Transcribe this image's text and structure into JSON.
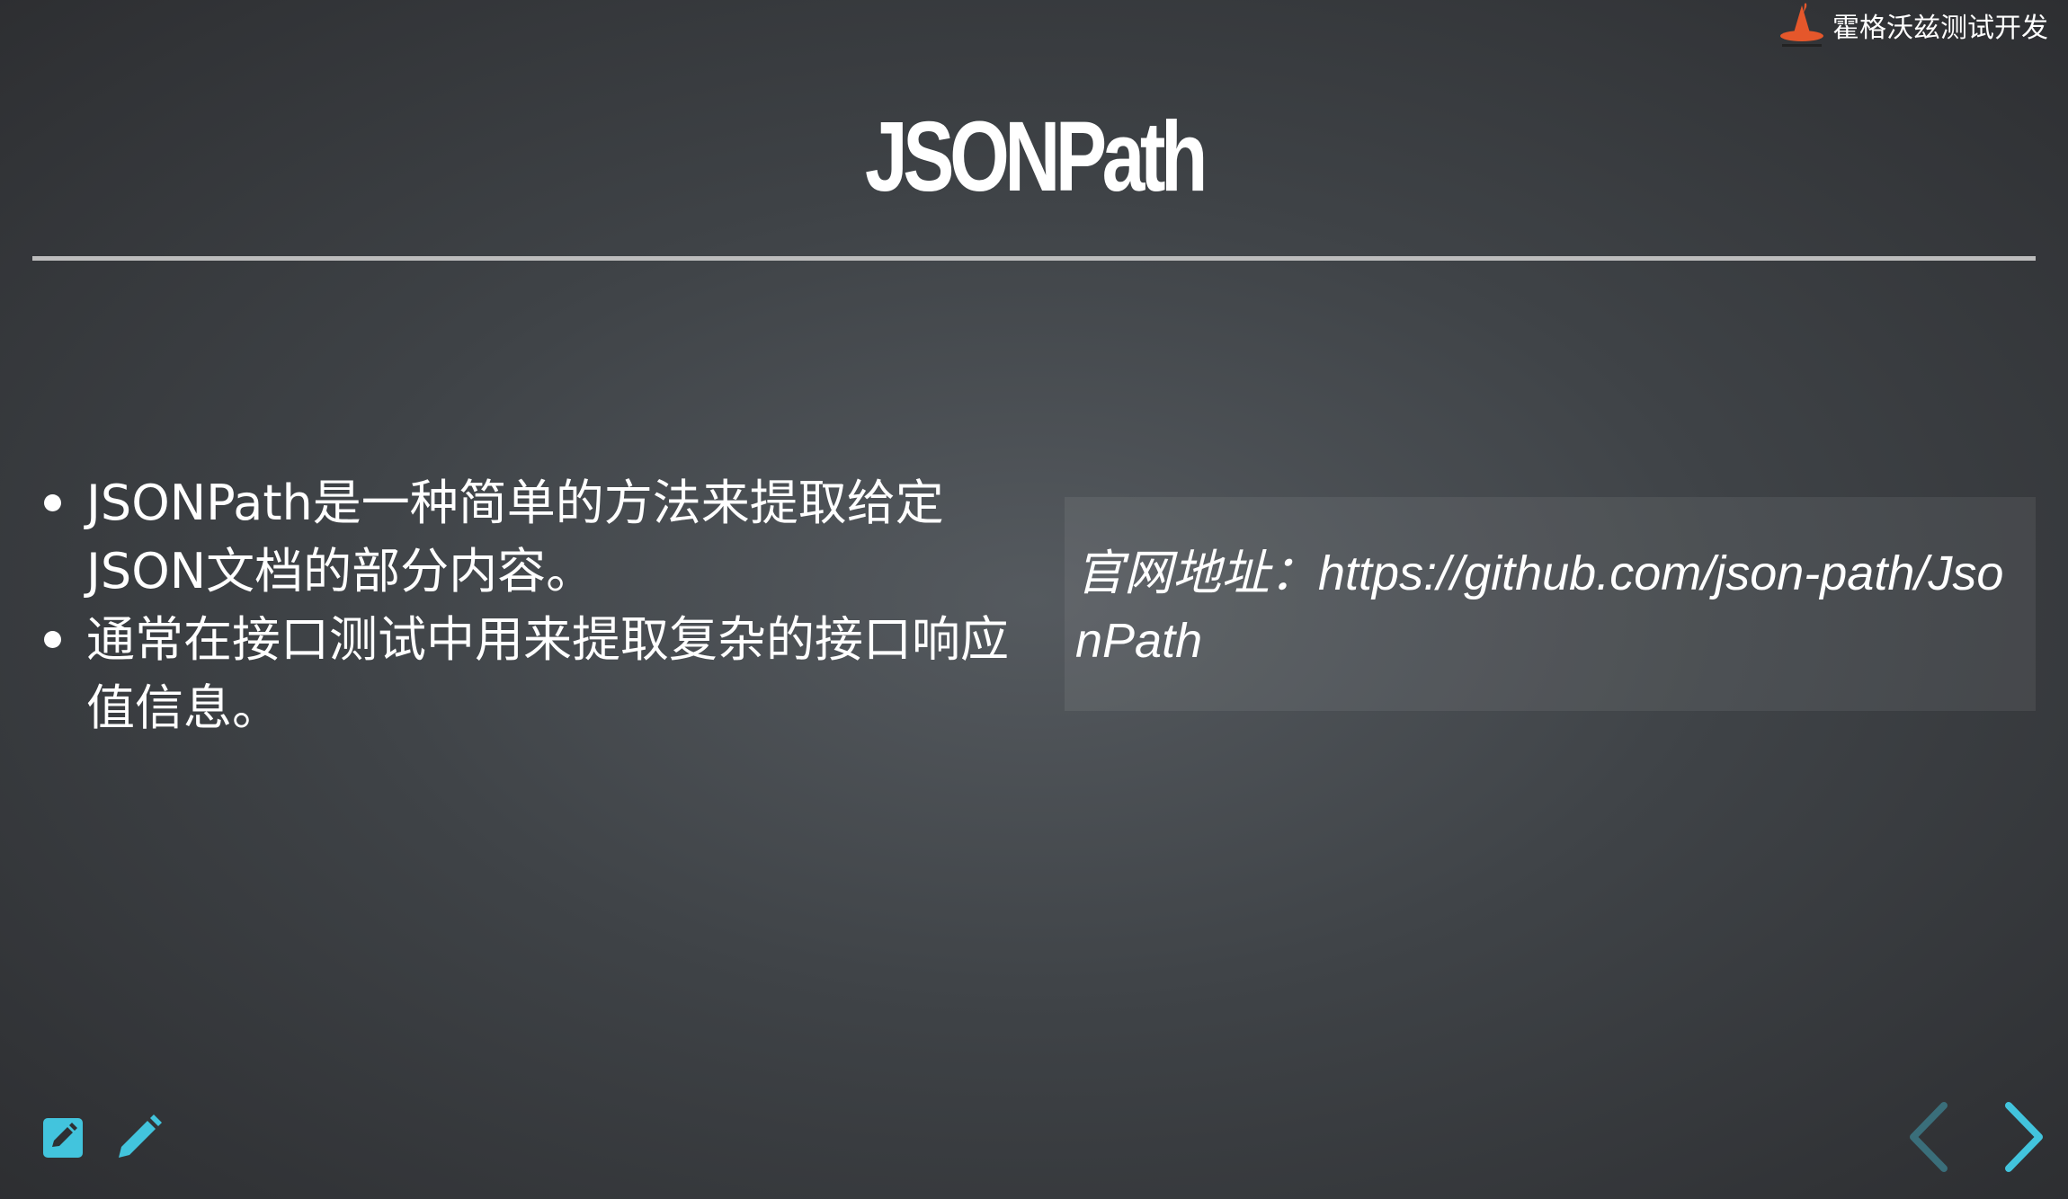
{
  "brand": {
    "name": "霍格沃兹测试开发",
    "logo_icon": "wizard-hat-icon"
  },
  "slide": {
    "title": "JSONPath",
    "bullets": [
      "JSONPath是一种简单的方法来提取给定JSON文档的部分内容。",
      "通常在接口测试中用来提取复杂的接口响应值信息。"
    ],
    "callout": "官网地址：https://github.com/json-path/JsonPath"
  },
  "toolbar": {
    "edit_icon": "edit-note-icon",
    "pen_icon": "pencil-icon"
  },
  "nav": {
    "prev_icon": "chevron-left-icon",
    "next_icon": "chevron-right-icon"
  },
  "colors": {
    "accent": "#42c4dd",
    "logo": "#e5572b",
    "background_dark": "#2b2c2f",
    "background_light": "#555a5f"
  }
}
